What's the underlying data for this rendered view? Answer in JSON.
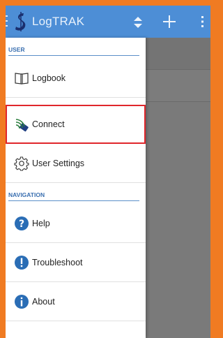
{
  "app": {
    "title": "LogTRAK"
  },
  "toolbar": {
    "sort_icon": "sort-updown-icon",
    "add_icon": "plus-icon",
    "more_icon": "more-vertical-icon"
  },
  "drawer": {
    "user_section": "USER",
    "navigation_section": "NAVIGATION",
    "items": [
      {
        "label": "Logbook",
        "icon": "book-icon"
      },
      {
        "label": "Connect",
        "icon": "wireless-connect-icon",
        "highlighted": true
      },
      {
        "label": "User Settings",
        "icon": "gear-icon"
      },
      {
        "label": "Help",
        "icon": "help-icon"
      },
      {
        "label": "Troubleshoot",
        "icon": "alert-icon"
      },
      {
        "label": "About",
        "icon": "info-icon"
      }
    ]
  },
  "colors": {
    "frame": "#f07b22",
    "appbar": "#4d8ed6",
    "section": "#3a6fb0",
    "highlight": "#e0262b"
  }
}
